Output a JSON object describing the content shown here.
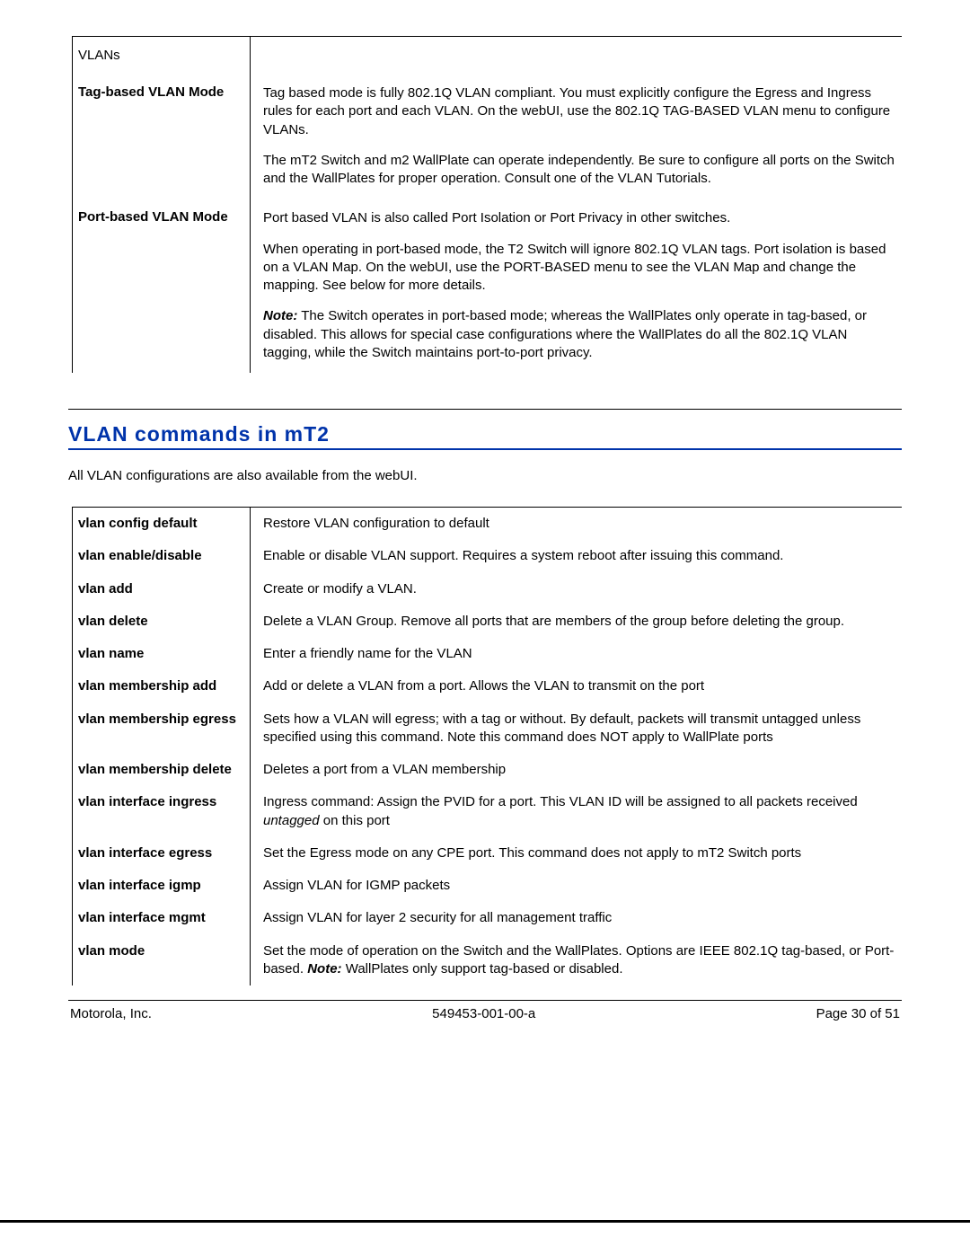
{
  "header": {
    "section": "VLANs"
  },
  "modes": [
    {
      "term": "Tag-based VLAN Mode",
      "paras": [
        "Tag based mode is fully 802.1Q VLAN compliant.  You must explicitly configure the Egress and Ingress rules for each port and each VLAN.  On the webUI, use the 802.1Q TAG-BASED VLAN menu to configure VLANs.",
        "The mT2 Switch and m2 WallPlate can operate independently.  Be sure to configure all ports on the Switch and the WallPlates for proper operation.  Consult one of the VLAN Tutorials."
      ]
    },
    {
      "term": "Port-based VLAN Mode",
      "paras": [
        "Port based VLAN is also called Port Isolation or Port Privacy in other switches.",
        "When operating in port-based mode, the T2 Switch will ignore 802.1Q VLAN tags.  Port isolation is based on a VLAN Map.  On the webUI, use the PORT-BASED menu to see the VLAN Map and change the mapping.  See below for more details."
      ],
      "note": {
        "label": "Note:",
        "text": "  The Switch operates in port-based mode; whereas the WallPlates only operate in tag-based, or disabled.  This allows for special case configurations where the WallPlates do all the 802.1Q VLAN tagging, while the Switch maintains port-to-port privacy."
      }
    }
  ],
  "section_title": "VLAN commands in mT2",
  "intro": "All VLAN configurations are also available from the webUI.",
  "commands": [
    {
      "term": "vlan config default",
      "desc": "Restore VLAN configuration to default"
    },
    {
      "term": "vlan enable/disable",
      "desc": "Enable or disable VLAN support.  Requires a system reboot after issuing this command."
    },
    {
      "term": "vlan add",
      "desc": "Create or modify a VLAN."
    },
    {
      "term": "vlan delete",
      "desc": "Delete a VLAN Group.  Remove all ports that are members of the group before deleting the group."
    },
    {
      "term": "vlan name",
      "desc": "Enter a friendly name for the VLAN"
    },
    {
      "term": "vlan membership add",
      "desc": "Add or delete a VLAN from a port.  Allows the VLAN to transmit on the port"
    },
    {
      "term": "vlan membership egress",
      "desc": "Sets how a VLAN will egress; with a tag or without.  By default, packets will transmit untagged unless specified using this command.  Note this command does NOT apply to WallPlate ports"
    },
    {
      "term": "vlan membership delete",
      "desc": "Deletes a port from a VLAN membership"
    },
    {
      "term": "vlan interface ingress",
      "desc_pre": "Ingress command:  Assign the PVID for a port.  This VLAN ID will be assigned to all packets received ",
      "desc_ital": "untagged",
      "desc_post": " on this port"
    },
    {
      "term": "vlan interface egress",
      "desc": "Set the Egress mode on any CPE port.  This command does not apply to mT2 Switch ports"
    },
    {
      "term": "vlan interface igmp",
      "desc": "Assign VLAN for IGMP packets"
    },
    {
      "term": "vlan interface mgmt",
      "desc": "Assign VLAN for layer 2 security for all management traffic"
    },
    {
      "term": "vlan mode",
      "desc_pre": "Set the mode of operation on the Switch and the WallPlates.  Options are IEEE 802.1Q tag-based, or Port-based.  ",
      "note_label": "Note:",
      "desc_post": "  WallPlates only support tag-based or disabled."
    }
  ],
  "footer": {
    "left": "Motorola, Inc.",
    "mid": "549453-001-00-a",
    "right": "Page 30 of 51"
  }
}
